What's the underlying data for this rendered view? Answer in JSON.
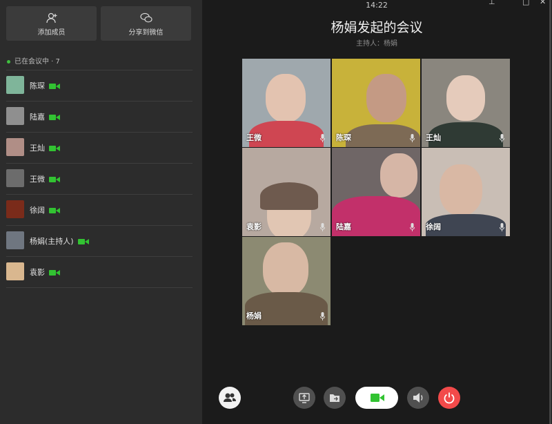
{
  "sidebar": {
    "add_member_label": "添加成员",
    "share_wechat_label": "分享到微信",
    "in_meeting_label": "已在会议中 · 7",
    "members": [
      {
        "name": "陈琛",
        "avatar_color": "#7fb59a"
      },
      {
        "name": "陆嘉",
        "avatar_color": "#8f8f8f"
      },
      {
        "name": "王灿",
        "avatar_color": "#b08e86"
      },
      {
        "name": "王微",
        "avatar_color": "#6c6c6c"
      },
      {
        "name": "徐阔",
        "avatar_color": "#7a2b1a"
      },
      {
        "name": "杨娟(主持人)",
        "avatar_color": "#6f7680"
      },
      {
        "name": "袁影",
        "avatar_color": "#d9b78f"
      }
    ]
  },
  "header": {
    "time": "14:22",
    "title": "杨娟发起的会议",
    "host": "主持人：杨娟"
  },
  "videos": [
    {
      "name": "王微",
      "bg": "#9fa8ad",
      "fg": "#cf4652"
    },
    {
      "name": "陈琛",
      "bg": "#c8b23a",
      "fg": "#7d6a55"
    },
    {
      "name": "王灿",
      "bg": "#8a867e",
      "fg": "#2f3a34"
    },
    {
      "name": "袁影",
      "bg": "#b7a9a0",
      "fg": "#6e5a4e"
    },
    {
      "name": "陆嘉",
      "bg": "#6f6666",
      "fg": "#c2306a"
    },
    {
      "name": "徐阔",
      "bg": "#c9beb5",
      "fg": "#3f4552"
    },
    {
      "name": "杨娟",
      "bg": "#8c8a72",
      "fg": "#6a5a48"
    }
  ],
  "colors": {
    "accent_green": "#32c332",
    "end_red": "#f24a4a"
  },
  "icons": [
    "add-member-icon",
    "wechat-icon",
    "camera-icon",
    "mic-icon",
    "members-icon",
    "screen-share-icon",
    "file-share-icon",
    "speaker-icon",
    "power-icon"
  ]
}
